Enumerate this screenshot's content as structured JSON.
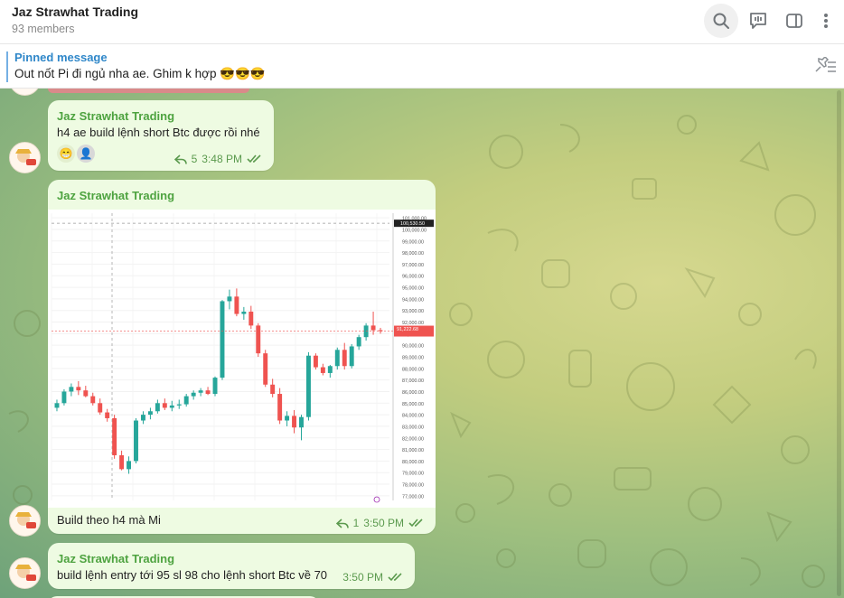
{
  "header": {
    "title": "Jaz Strawhat Trading",
    "members": "93 members"
  },
  "pinned": {
    "title": "Pinned message",
    "text": "Out nốt Pi đi ngủ nha ae. Ghim k hợp 😎😎😎"
  },
  "messages": [
    {
      "sender": "Jaz Strawhat Trading",
      "text": "h4 ae build lệnh short Btc được rồi nhé",
      "reactions": [
        "😁",
        "👤"
      ],
      "replies": "5",
      "time": "3:48 PM"
    },
    {
      "sender": "Jaz Strawhat Trading",
      "text": "Build theo h4 mà Mi",
      "replies": "1",
      "time": "3:50 PM"
    },
    {
      "sender": "Jaz Strawhat Trading",
      "text": "build lệnh entry tới 95 sl 98 cho lệnh short Btc về 70",
      "time": "3:50 PM"
    }
  ],
  "chart_data": {
    "type": "candlestick",
    "y_ticks": [
      "101,000.00",
      "100,000.00",
      "99,000.00",
      "98,000.00",
      "97,000.00",
      "96,000.00",
      "95,000.00",
      "94,000.00",
      "93,000.00",
      "92,000.00",
      "91,000.00",
      "90,000.00",
      "89,000.00",
      "88,000.00",
      "87,000.00",
      "86,000.00",
      "85,000.00",
      "84,000.00",
      "83,000.00",
      "82,000.00",
      "81,000.00",
      "80,000.00",
      "79,000.00",
      "78,000.00",
      "77,000.00"
    ],
    "ylim": [
      76600,
      101400
    ],
    "last_price_label": "91,222.68",
    "cursor_price_label": "100,530.50",
    "colors": {
      "up": "#26a69a",
      "down": "#ef5350"
    },
    "candles": [
      [
        84600,
        85300,
        84300,
        85000
      ],
      [
        85000,
        86200,
        84800,
        86000
      ],
      [
        86000,
        86700,
        85600,
        86400
      ],
      [
        86400,
        86900,
        85700,
        86100
      ],
      [
        86100,
        86500,
        85500,
        85600
      ],
      [
        85600,
        85900,
        84800,
        85000
      ],
      [
        85000,
        85400,
        84000,
        84200
      ],
      [
        84200,
        84500,
        83400,
        83700
      ],
      [
        83700,
        84000,
        80200,
        80500
      ],
      [
        80500,
        80900,
        79200,
        79300
      ],
      [
        79300,
        80400,
        78900,
        80000
      ],
      [
        80000,
        83700,
        79800,
        83500
      ],
      [
        83500,
        84300,
        83200,
        84000
      ],
      [
        84000,
        84600,
        83600,
        84300
      ],
      [
        84300,
        85300,
        84100,
        85000
      ],
      [
        85000,
        85400,
        84400,
        84600
      ],
      [
        84600,
        85200,
        84300,
        84800
      ],
      [
        84800,
        85300,
        84500,
        84900
      ],
      [
        84900,
        85800,
        84700,
        85600
      ],
      [
        85600,
        86100,
        85300,
        85900
      ],
      [
        85900,
        86300,
        85600,
        86100
      ],
      [
        86100,
        86400,
        85700,
        85800
      ],
      [
        85800,
        87300,
        85600,
        87200
      ],
      [
        87200,
        93900,
        87000,
        93800
      ],
      [
        93800,
        94800,
        93100,
        94200
      ],
      [
        94200,
        94900,
        92500,
        92700
      ],
      [
        92700,
        93300,
        92200,
        92900
      ],
      [
        92900,
        93400,
        91400,
        91700
      ],
      [
        91700,
        91900,
        89000,
        89300
      ],
      [
        89300,
        89600,
        86400,
        86600
      ],
      [
        86600,
        87100,
        85500,
        85800
      ],
      [
        85800,
        86300,
        83200,
        83500
      ],
      [
        83500,
        84300,
        83000,
        83900
      ],
      [
        83900,
        84400,
        82400,
        82900
      ],
      [
        82900,
        84000,
        81800,
        83800
      ],
      [
        83800,
        89400,
        83500,
        89100
      ],
      [
        89100,
        89300,
        87900,
        88100
      ],
      [
        88100,
        88400,
        87400,
        87600
      ],
      [
        87600,
        88300,
        87200,
        88200
      ],
      [
        88200,
        89800,
        87900,
        89600
      ],
      [
        89600,
        90200,
        87900,
        88200
      ],
      [
        88200,
        90100,
        88000,
        89900
      ],
      [
        89900,
        90900,
        89600,
        90700
      ],
      [
        90700,
        91900,
        90400,
        91700
      ],
      [
        91700,
        92900,
        90900,
        91300
      ],
      [
        91300,
        91500,
        91000,
        91220
      ]
    ]
  }
}
